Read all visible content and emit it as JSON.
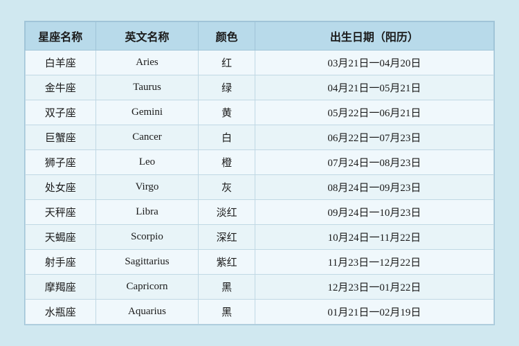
{
  "table": {
    "headers": {
      "zh_name": "星座名称",
      "en_name": "英文名称",
      "color": "颜色",
      "date": "出生日期（阳历）"
    },
    "rows": [
      {
        "zh": "白羊座",
        "en": "Aries",
        "color": "红",
        "date": "03月21日一04月20日"
      },
      {
        "zh": "金牛座",
        "en": "Taurus",
        "color": "绿",
        "date": "04月21日一05月21日"
      },
      {
        "zh": "双子座",
        "en": "Gemini",
        "color": "黄",
        "date": "05月22日一06月21日"
      },
      {
        "zh": "巨蟹座",
        "en": "Cancer",
        "color": "白",
        "date": "06月22日一07月23日"
      },
      {
        "zh": "狮子座",
        "en": "Leo",
        "color": "橙",
        "date": "07月24日一08月23日"
      },
      {
        "zh": "处女座",
        "en": "Virgo",
        "color": "灰",
        "date": "08月24日一09月23日"
      },
      {
        "zh": "天秤座",
        "en": "Libra",
        "color": "淡红",
        "date": "09月24日一10月23日"
      },
      {
        "zh": "天蝎座",
        "en": "Scorpio",
        "color": "深红",
        "date": "10月24日一11月22日"
      },
      {
        "zh": "射手座",
        "en": "Sagittarius",
        "color": "紫红",
        "date": "11月23日一12月22日"
      },
      {
        "zh": "摩羯座",
        "en": "Capricorn",
        "color": "黑",
        "date": "12月23日一01月22日"
      },
      {
        "zh": "水瓶座",
        "en": "Aquarius",
        "color": "黑",
        "date": "01月21日一02月19日"
      }
    ]
  }
}
